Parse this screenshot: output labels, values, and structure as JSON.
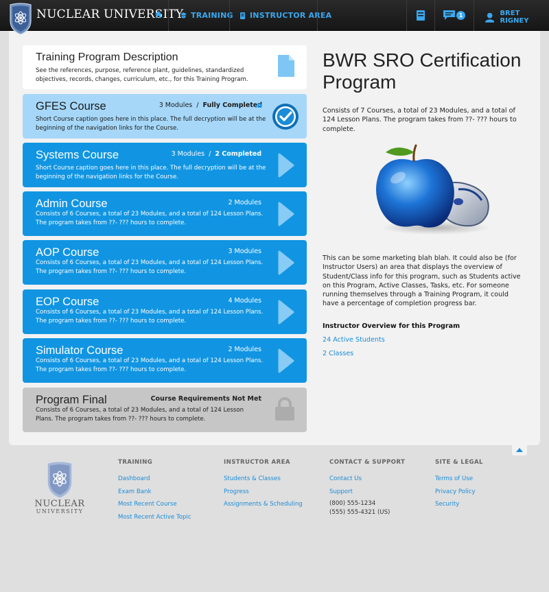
{
  "nav": {
    "brand": "NUCLEAR UNIVERSITY",
    "training": "TRAINING",
    "instructor_area": "INSTRUCTOR AREA",
    "message_count": "1",
    "user_name": "BRET RIGNEY"
  },
  "description_card": {
    "title": "Training Program Description",
    "text": "See the references, purpose, reference plant, guidelines, standardized objectives, records, changes, curriculum, etc., for this Training Program."
  },
  "courses": [
    {
      "title": "GFES Course",
      "modules": "3 Modules",
      "sep": "/",
      "status": "Fully Completed",
      "text": "Short Course caption goes here in this place. The full decryption will be at the beginning of the navigation links for the Course."
    },
    {
      "title": "Systems Course",
      "modules": "3 Modules",
      "sep": "/",
      "status": "2 Completed",
      "text": "Short Course caption goes here in this place. The full decryption will be at the beginning of the navigation links for the Course."
    },
    {
      "title": "Admin Course",
      "modules": "2 Modules",
      "text": "Consists of 6 Courses, a total of 23 Modules, and a total of 124 Lesson Plans. The program takes from ??- ??? hours to complete."
    },
    {
      "title": "AOP Course",
      "modules": "3 Modules",
      "text": "Consists of 6 Courses, a total of 23 Modules, and a total of 124 Lesson Plans. The program takes from ??- ??? hours to complete."
    },
    {
      "title": "EOP Course",
      "modules": "4 Modules",
      "text": "Consists of 6 Courses, a total of 23 Modules, and a total of 124 Lesson Plans. The program takes from ??- ??? hours to complete."
    },
    {
      "title": "Simulator Course",
      "modules": "2 Modules",
      "text": "Consists of 6 Courses, a total of 23 Modules, and a total of 124 Lesson Plans. The program takes from ??- ??? hours to complete."
    }
  ],
  "final": {
    "title": "Program Final",
    "status": "Course Requirements Not Met",
    "text": "Consists of 6 Courses, a total of 23 Modules, and a total of 124 Lesson Plans. The program takes from ??- ??? hours to complete."
  },
  "program": {
    "title": "BWR SRO Certification Program",
    "summary": "Consists of 7 Courses, a total of 23 Modules, and a total of 124 Lesson Plans. The program takes from ??- ??? hours to complete.",
    "marketing": "This can be some marketing blah blah. It could also be (for Instructor Users) an area that displays the overview of Student/Class info for this program, such as Students active on this Program, Active Classes, Tasks, etc. For someone running themselves through a Training Program, it could have a percentage of completion progress bar.",
    "overview_heading": "Instructor Overview for this Program",
    "active_students": "24 Active Students",
    "classes": "2 Classes"
  },
  "footer": {
    "brand_line1": "NUCLEAR",
    "brand_line2": "UNIVERSITY",
    "training": {
      "heading": "TRAINING",
      "links": [
        "Dashboard",
        "Exam Bank",
        "Most Recent Course",
        "Most Recent Active Topic"
      ]
    },
    "instructor": {
      "heading": "INSTRUCTOR AREA",
      "links": [
        "Students & Classes",
        "Progress",
        "Assignments & Scheduling"
      ]
    },
    "contact": {
      "heading": "CONTACT & SUPPORT",
      "links": [
        "Contact Us",
        "Support"
      ],
      "phone1": "(800) 555-1234",
      "phone2": "(555) 555-4321 (US)"
    },
    "legal": {
      "heading": "SITE & LEGAL",
      "links": [
        "Terms of Use",
        "Privacy Policy",
        "Security"
      ]
    }
  },
  "colors": {
    "accent": "#1195e2",
    "light_card": "#a6d7f8",
    "locked_card": "#c6c6c6",
    "nav_bg": "#1c1c1c"
  },
  "icons": [
    "shield-logo-icon",
    "home-icon",
    "training-icon",
    "instructor-icon",
    "bookmark-icon",
    "chat-icon",
    "user-icon",
    "document-icon",
    "checkmark-icon",
    "arrow-right-icon",
    "lock-icon",
    "bar-chart-icon",
    "up-arrow-icon",
    "apple-mouse-image"
  ]
}
